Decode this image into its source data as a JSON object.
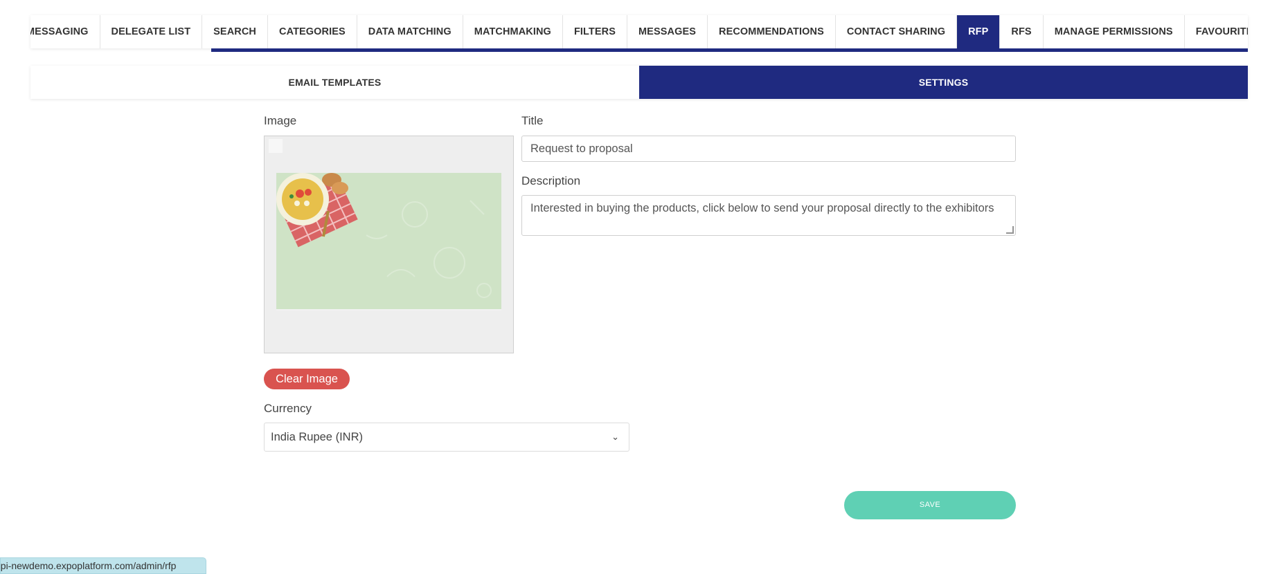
{
  "topnav": {
    "tabs": [
      {
        "label": "MESSAGING"
      },
      {
        "label": "DELEGATE LIST"
      },
      {
        "label": "SEARCH"
      },
      {
        "label": "CATEGORIES"
      },
      {
        "label": "DATA MATCHING"
      },
      {
        "label": "MATCHMAKING"
      },
      {
        "label": "FILTERS"
      },
      {
        "label": "MESSAGES"
      },
      {
        "label": "RECOMMENDATIONS"
      },
      {
        "label": "CONTACT SHARING"
      },
      {
        "label": "RFP",
        "active": true
      },
      {
        "label": "RFS"
      },
      {
        "label": "MANAGE PERMISSIONS"
      },
      {
        "label": "FAVOURITE DASHBOARD"
      }
    ],
    "active_color": "#1f2a80"
  },
  "subtabs": {
    "email_templates": "EMAIL TEMPLATES",
    "settings": "SETTINGS"
  },
  "form": {
    "image_label": "Image",
    "title_label": "Title",
    "title_value": "Request to proposal",
    "description_label": "Description",
    "description_value": "Interested in buying the products, click below to send your proposal directly to the exhibitors",
    "clear_image_label": "Clear Image",
    "currency_label": "Currency",
    "currency_value": "India Rupee (INR)",
    "save_label": "SAVE"
  },
  "status_bar": {
    "url": "api-newdemo.expoplatform.com/admin/rfp"
  },
  "colors": {
    "primary": "#1f2a80",
    "danger": "#d9534f",
    "save": "#5fd0b4"
  }
}
